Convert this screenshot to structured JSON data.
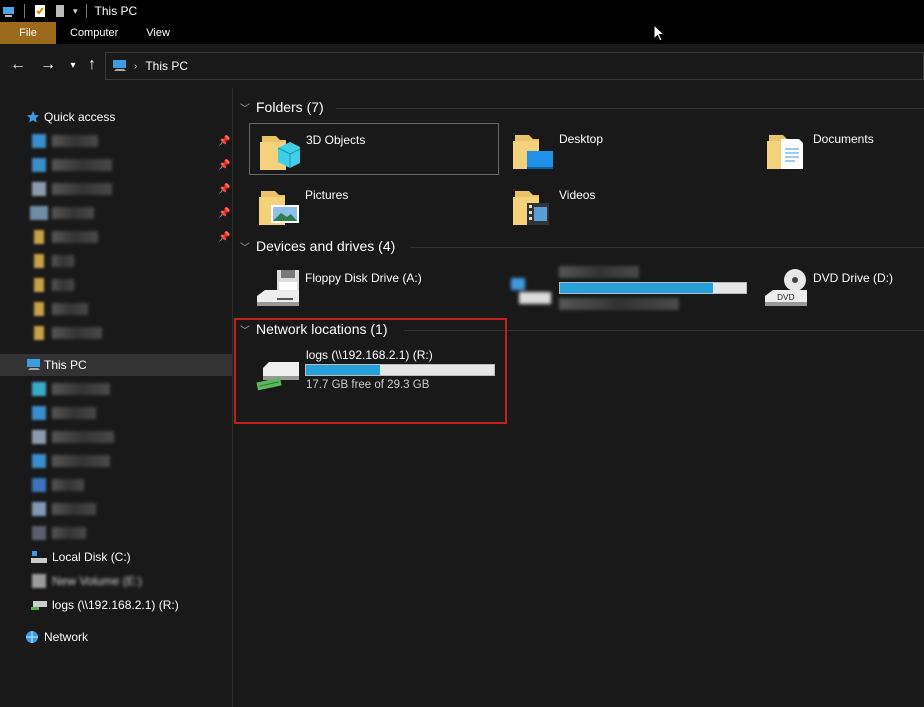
{
  "window": {
    "title": "This PC"
  },
  "ribbon": {
    "tabs": [
      "File",
      "Computer",
      "View"
    ]
  },
  "address": {
    "crumb": "This PC"
  },
  "sidebar": {
    "quick_access": "Quick access",
    "this_pc": "This PC",
    "local_disk": "Local Disk (C:)",
    "new_volume": "New Volume (E:)",
    "logs_drive": "logs (\\\\192.168.2.1) (R:)",
    "network": "Network"
  },
  "folders": {
    "title": "Folders (7)",
    "items": [
      "3D Objects",
      "Desktop",
      "Documents",
      "Pictures",
      "Videos"
    ]
  },
  "devices": {
    "title": "Devices and drives (4)",
    "floppy": "Floppy Disk Drive (A:)",
    "dvd": "DVD Drive (D:)",
    "blurred_drive_fill": 0.82
  },
  "network_locations": {
    "title": "Network locations (1)",
    "drive_name": "logs (\\\\192.168.2.1) (R:)",
    "free_text": "17.7 GB free of 29.3 GB",
    "used_fraction": 0.396
  },
  "colors": {
    "accent": "#26a0da",
    "file_tab": "#9b6b1b",
    "highlight_border": "#c41e1e"
  }
}
